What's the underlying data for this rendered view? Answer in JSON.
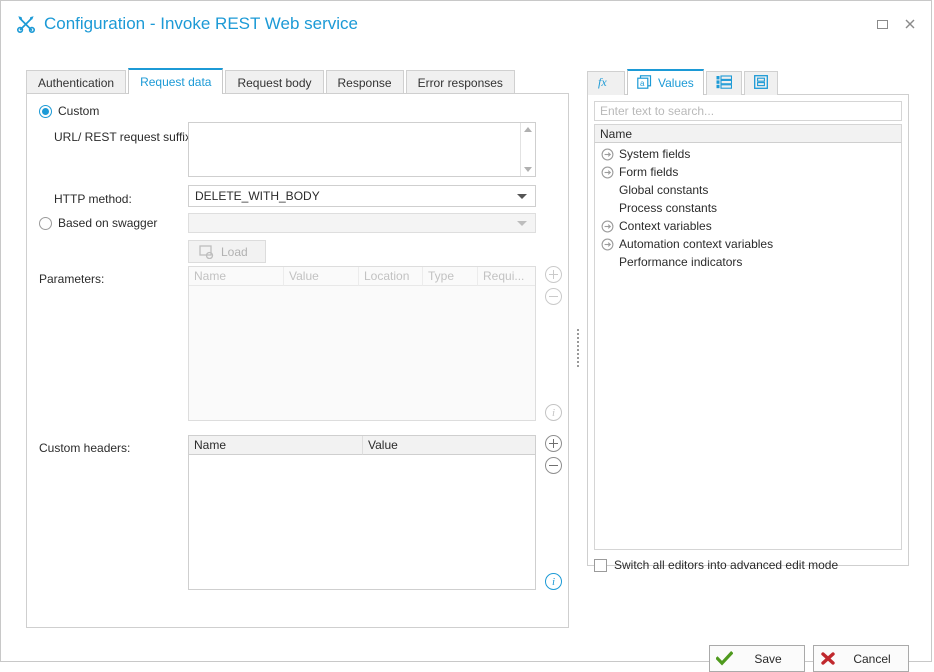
{
  "window": {
    "title": "Configuration - Invoke REST Web service",
    "title_icon": "tools-icon",
    "controls": [
      {
        "name": "restore-button",
        "icon": "restore-icon"
      },
      {
        "name": "close-button",
        "icon": "close-icon",
        "glyph": "✕"
      }
    ]
  },
  "colors": {
    "accent": "#1c9ad6",
    "save_green": "#4f9a1e",
    "cancel_red": "#c0282d",
    "border": "#cfcfcf"
  },
  "left": {
    "tabs": [
      {
        "label": "Authentication",
        "active": false
      },
      {
        "label": "Request data",
        "active": true
      },
      {
        "label": "Request body",
        "active": false
      },
      {
        "label": "Response",
        "active": false
      },
      {
        "label": "Error responses",
        "active": false
      }
    ],
    "radio_custom": {
      "label": "Custom",
      "checked": true
    },
    "radio_swagger": {
      "label": "Based on swagger",
      "checked": false
    },
    "url_label": "URL/ REST request suffix:",
    "url_value": "",
    "http_label": "HTTP method:",
    "http_value": "DELETE_WITH_BODY",
    "swagger_value": "",
    "load_button": {
      "label": "Load",
      "icon": "load-refresh-icon",
      "enabled": false
    },
    "parameters": {
      "label": "Parameters:",
      "columns": [
        "Name",
        "Value",
        "Location",
        "Type",
        "Requi..."
      ],
      "rows": [],
      "enabled": false,
      "add_button": "add-parameter-button",
      "remove_button": "remove-parameter-button",
      "info_button": "parameters-info-button"
    },
    "custom_headers": {
      "label": "Custom headers:",
      "columns": [
        "Name",
        "Value"
      ],
      "rows": [],
      "enabled": true,
      "add_button": "add-header-button",
      "remove_button": "remove-header-button",
      "info_button": "custom-headers-info-button"
    }
  },
  "right": {
    "tabs": [
      {
        "label": "",
        "icon": "function-fx-icon",
        "active": false
      },
      {
        "label": "Values",
        "icon": "values-a-icon",
        "active": true
      },
      {
        "label": "",
        "icon": "list-icon",
        "active": false
      },
      {
        "label": "",
        "icon": "form-box-icon",
        "active": false
      }
    ],
    "search_placeholder": "Enter text to search...",
    "search_value": "",
    "tree_header": "Name",
    "tree_items": [
      {
        "label": "System fields",
        "expandable": true
      },
      {
        "label": "Form fields",
        "expandable": true
      },
      {
        "label": "Global constants",
        "expandable": false
      },
      {
        "label": "Process constants",
        "expandable": false
      },
      {
        "label": "Context variables",
        "expandable": true
      },
      {
        "label": "Automation context variables",
        "expandable": true
      },
      {
        "label": "Performance indicators",
        "expandable": false
      }
    ],
    "advanced_checkbox": {
      "label": "Switch all editors into advanced edit mode",
      "checked": false
    }
  },
  "footer": {
    "save_label": "Save",
    "cancel_label": "Cancel"
  }
}
